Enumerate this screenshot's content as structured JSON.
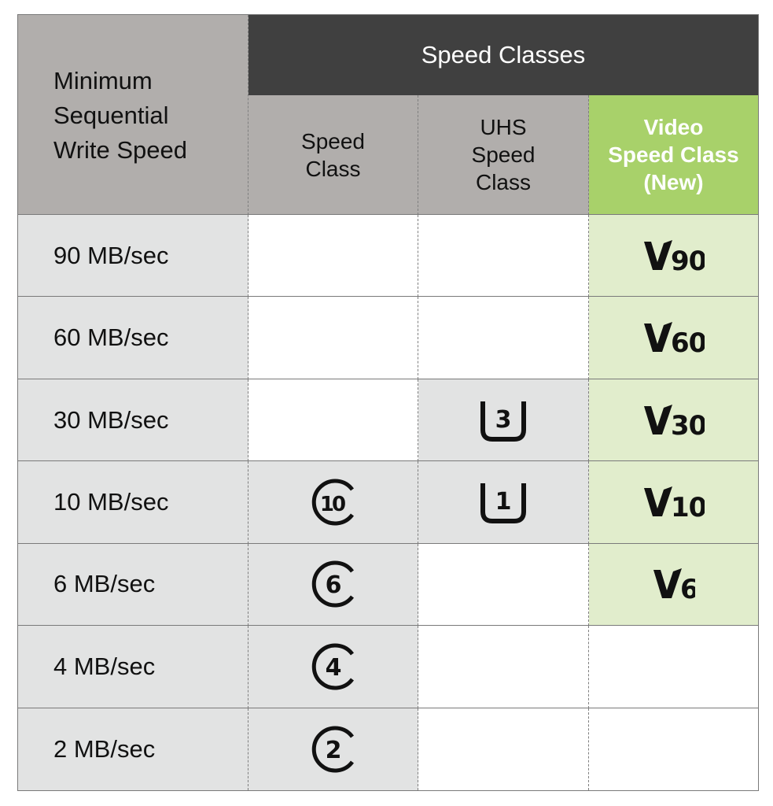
{
  "header": {
    "corner_label": "Minimum\nSequential\nWrite Speed",
    "group_label": "Speed Classes",
    "columns": [
      {
        "key": "speed_class",
        "label": "Speed\nClass"
      },
      {
        "key": "uhs_speed_class",
        "label": "UHS\nSpeed\nClass"
      },
      {
        "key": "video_speed_class",
        "label": "Video\nSpeed Class\n(New)"
      }
    ]
  },
  "colors": {
    "group_header_bg": "#404040",
    "subheader_bg": "#b1aeac",
    "video_header_bg": "#a8d16a",
    "video_cell_bg": "#e1edcc",
    "filled_cell_bg": "#e2e3e3"
  },
  "rows": [
    {
      "speed": "90 MB/sec",
      "speed_class": null,
      "uhs": null,
      "video": "90"
    },
    {
      "speed": "60 MB/sec",
      "speed_class": null,
      "uhs": null,
      "video": "60"
    },
    {
      "speed": "30 MB/sec",
      "speed_class": null,
      "uhs": "3",
      "video": "30"
    },
    {
      "speed": "10 MB/sec",
      "speed_class": "10",
      "uhs": "1",
      "video": "10"
    },
    {
      "speed": "6 MB/sec",
      "speed_class": "6",
      "uhs": null,
      "video": "6"
    },
    {
      "speed": "4 MB/sec",
      "speed_class": "4",
      "uhs": null,
      "video": null
    },
    {
      "speed": "2 MB/sec",
      "speed_class": "2",
      "uhs": null,
      "video": null
    }
  ],
  "icons": {
    "speed_class": "c-circle-class-icon",
    "uhs": "u-bracket-uhs-icon",
    "video": "v-video-class-icon"
  }
}
